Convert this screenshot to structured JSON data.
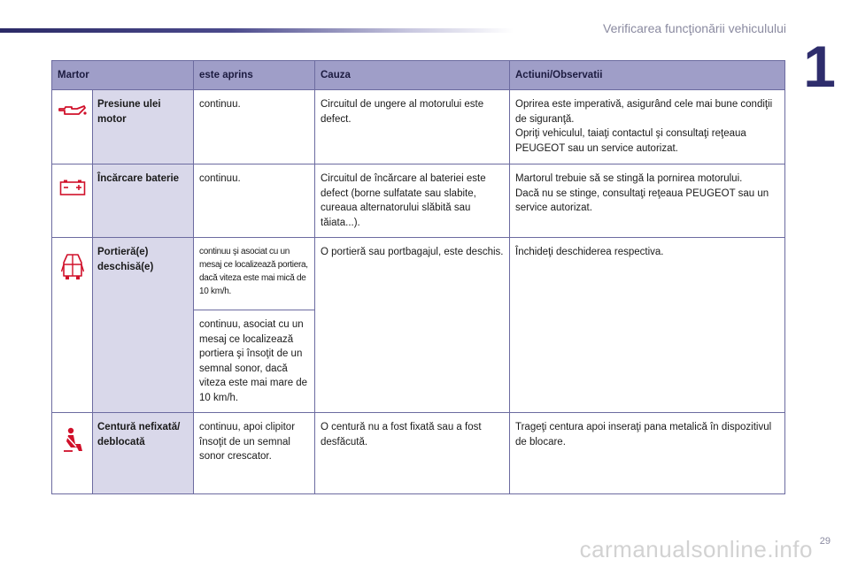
{
  "header": {
    "section_title": "Verificarea funcţionării vehiculului",
    "chapter": "1"
  },
  "table": {
    "columns": [
      "Martor",
      "este aprins",
      "Cauza",
      "Actiuni/Observatii"
    ],
    "rows": [
      {
        "icon": "oil-pressure-icon",
        "name": "Presiune ulei motor",
        "state": "continuu.",
        "cause": "Circuitul de ungere al motorului este defect.",
        "action": "Oprirea este imperativă, asigurând cele mai bune condiţii de siguranţă.\nOpriţi vehiculul, taiaţi contactul şi consultaţi reţeaua PEUGEOT sau un service autorizat."
      },
      {
        "icon": "battery-charge-icon",
        "name": "Încărcare baterie",
        "state": "continuu.",
        "cause": "Circuitul de încărcare al bateriei este defect (borne sulfatate sau slabite, cureaua alternatorului slăbită sau tăiata...).",
        "action": "Martorul trebuie să se stingă la pornirea motorului.\nDacă nu se stinge, consultaţi reţeaua PEUGEOT sau un service autorizat."
      },
      {
        "icon": "door-open-icon",
        "name": "Portieră(e) deschisă(e)",
        "state": "continuu şi asociat cu un mesaj ce localizează portiera, dacă viteza este mai mică de 10 km/h.",
        "state2": "continuu, asociat cu un mesaj ce localizează portiera şi însoţit de un semnal sonor, dacă viteza este mai mare de 10 km/h.",
        "cause": "O portieră sau portbagajul, este deschis.",
        "action": "Închideţi deschiderea respectiva."
      },
      {
        "icon": "seatbelt-icon",
        "name": "Centură nefixată/ deblocată",
        "state": "continuu, apoi clipitor însoţit de un semnal sonor crescator.",
        "cause": "O centură nu a fost fixată sau a fost desfăcută.",
        "action": "Trageţi centura apoi inseraţi pana metalică în dispozitivul de blocare."
      }
    ]
  },
  "footer": {
    "page_number": "29",
    "watermark": "carmanualsonline.info"
  },
  "colors": {
    "header_bg": "#9f9ec8",
    "name_cell_bg": "#d9d8ea",
    "icon_red": "#d0102a",
    "accent": "#2e2d6c"
  }
}
